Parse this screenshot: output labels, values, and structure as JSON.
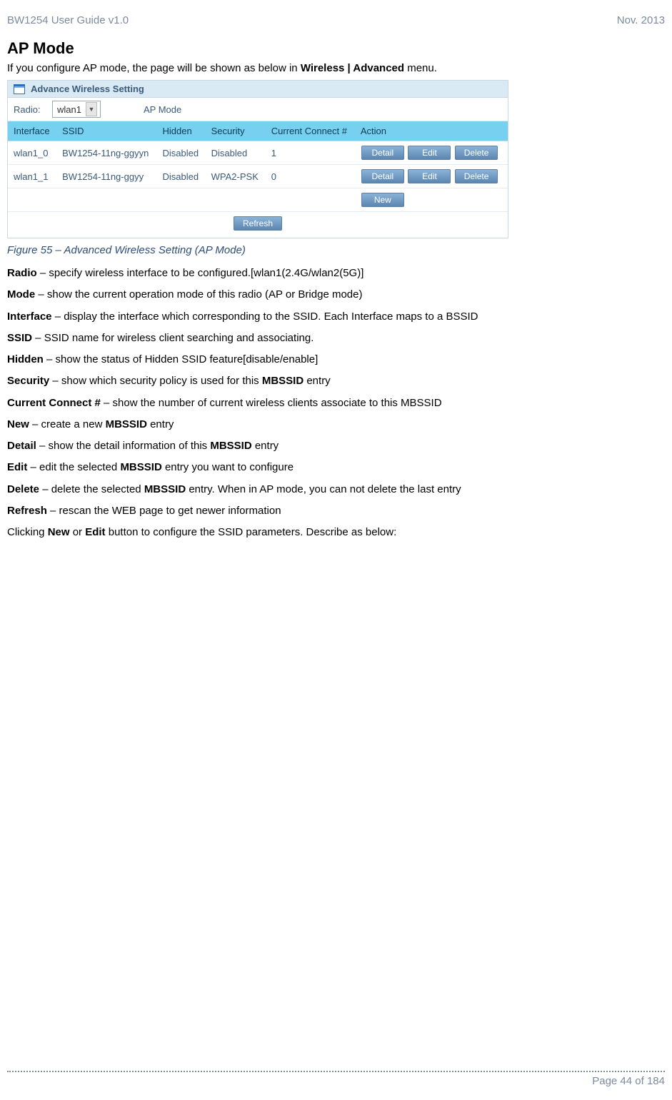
{
  "header": {
    "doc_title_left": "BW1254 User Guide v1.0",
    "doc_title_right": "Nov.  2013"
  },
  "section_title": "AP Mode",
  "intro_prefix": "If you configure AP mode, the page will be shown as below in ",
  "intro_bold": "Wireless | Advanced",
  "intro_suffix": " menu.",
  "panel": {
    "title": "Advance Wireless Setting",
    "radio_label": "Radio:",
    "radio_value": "wlan1",
    "mode_text": "AP Mode",
    "columns": [
      "Interface",
      "SSID",
      "Hidden",
      "Security",
      "Current Connect #",
      "Action"
    ],
    "rows": [
      {
        "iface": "wlan1_0",
        "ssid": "BW1254-11ng-ggyyn",
        "hidden": "Disabled",
        "security": "Disabled",
        "conn": "1"
      },
      {
        "iface": "wlan1_1",
        "ssid": "BW1254-11ng-ggyy",
        "hidden": "Disabled",
        "security": "WPA2-PSK",
        "conn": "0"
      }
    ],
    "btn_detail": "Detail",
    "btn_edit": "Edit",
    "btn_delete": "Delete",
    "btn_new": "New",
    "btn_refresh": "Refresh"
  },
  "caption": "Figure 55 – Advanced Wireless Setting (AP Mode)",
  "defs": {
    "radio_b": "Radio",
    "radio_t": " – specify wireless interface to be configured.[wlan1(2.4G/wlan2(5G)]",
    "mode_b": "Mode",
    "mode_t": " – show the current operation mode of this radio (AP or Bridge mode)",
    "iface_b": "Interface",
    "iface_t": " – display the interface which corresponding to the SSID. Each Interface maps to a BSSID",
    "ssid_b": "SSID",
    "ssid_t": " – SSID name for wireless client searching and associating.",
    "hidden_b": "Hidden",
    "hidden_t": " – show the status of Hidden SSID feature[disable/enable]",
    "security_b": "Security",
    "security_t1": " – show which security policy is used for this ",
    "security_mb": "MBSSID",
    "security_t2": " entry",
    "curr_b": "Current Connect #",
    "curr_t": " – show the number of current wireless clients associate to  this MBSSID",
    "new_b": "New",
    "new_t1": " – create a new ",
    "new_mb": "MBSSID",
    "new_t2": " entry",
    "detail_b": "Detail",
    "detail_t1": " – show the detail information of this ",
    "detail_mb": "MBSSID",
    "detail_t2": " entry",
    "edit_b": "Edit",
    "edit_t1": " – edit the selected ",
    "edit_mb": "MBSSID",
    "edit_t2": " entry you want to configure",
    "del_b": "Delete",
    "del_t1": " – delete the selected ",
    "del_mb": "MBSSID",
    "del_t2": " entry. When in AP mode, you can not delete the last entry",
    "refresh_b": "Refresh",
    "refresh_t": " – rescan the WEB page to get newer information",
    "click_t1": "Clicking ",
    "click_b1": "New",
    "click_t2": " or ",
    "click_b2": "Edit",
    "click_t3": " button to configure the SSID parameters. Describe as below:"
  },
  "footer": {
    "page_text": "Page 44 of 184"
  }
}
